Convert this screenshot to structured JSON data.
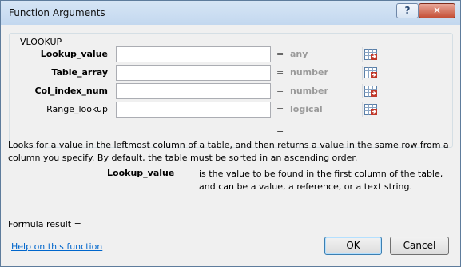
{
  "window": {
    "title": "Function Arguments",
    "help_glyph": "?",
    "close_glyph": "✕"
  },
  "function_name": "VLOOKUP",
  "arguments": [
    {
      "label": "Lookup_value",
      "bold": true,
      "value": "",
      "equals": "=",
      "type": "any"
    },
    {
      "label": "Table_array",
      "bold": true,
      "value": "",
      "equals": "=",
      "type": "number"
    },
    {
      "label": "Col_index_num",
      "bold": true,
      "value": "",
      "equals": "=",
      "type": "number"
    },
    {
      "label": "Range_lookup",
      "bold": false,
      "value": "",
      "equals": "=",
      "type": "logical"
    }
  ],
  "function_result_equals": "=",
  "description": "Looks for a value in the leftmost column of a table, and then returns a value in the same row from a column you specify. By default, the table must be sorted in an ascending order.",
  "argument_help": {
    "name": "Lookup_value",
    "text": "is the value to be found in the first column of the table, and can be a value, a reference, or a text string."
  },
  "formula_result_label": "Formula result =",
  "help_link": "Help on this function",
  "buttons": {
    "ok": "OK",
    "cancel": "Cancel"
  },
  "icons": {
    "collapse_dialog": "range-selector-icon"
  }
}
